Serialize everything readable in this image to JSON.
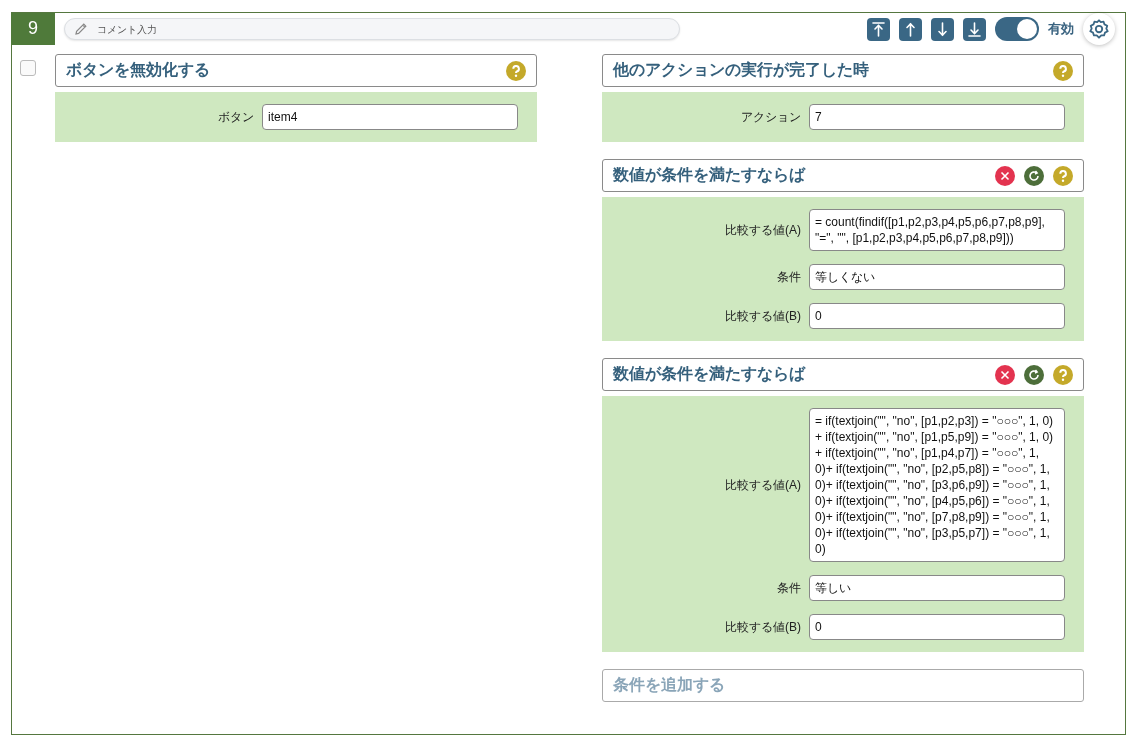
{
  "row_number": "9",
  "comment": {
    "placeholder": "コメント入力"
  },
  "toolbar": {
    "enabled": {
      "on": true,
      "label": "有効"
    }
  },
  "select": {
    "checked": false
  },
  "action": {
    "title": "ボタンを無効化する",
    "fields": [
      {
        "label": "ボタン",
        "value": "item4"
      }
    ]
  },
  "trigger": {
    "title": "他のアクションの実行が完了した時",
    "fields": [
      {
        "label": "アクション",
        "value": "7"
      }
    ]
  },
  "conditions": [
    {
      "title": "数値が条件を満たすならば",
      "fields": [
        {
          "label": "比較する値(A)",
          "value": "= count(findif([p1,p2,p3,p4,p5,p6,p7,p8,p9], \"=\", \"\", [p1,p2,p3,p4,p5,p6,p7,p8,p9]))"
        },
        {
          "label": "条件",
          "value": "等しくない"
        },
        {
          "label": "比較する値(B)",
          "value": "0"
        }
      ]
    },
    {
      "title": "数値が条件を満たすならば",
      "fields": [
        {
          "label": "比較する値(A)",
          "value": "= if(textjoin(\"\", \"no\", [p1,p2,p3]) = \"○○○\", 1, 0) +  if(textjoin(\"\", \"no\", [p1,p5,p9]) = \"○○○\", 1, 0) +  if(textjoin(\"\", \"no\", [p1,p4,p7]) = \"○○○\", 1, 0)+ if(textjoin(\"\", \"no\", [p2,p5,p8]) = \"○○○\", 1, 0)+ if(textjoin(\"\", \"no\", [p3,p6,p9]) = \"○○○\", 1, 0)+ if(textjoin(\"\", \"no\", [p4,p5,p6]) = \"○○○\", 1, 0)+ if(textjoin(\"\", \"no\", [p7,p8,p9]) = \"○○○\", 1, 0)+ if(textjoin(\"\", \"no\", [p3,p5,p7]) = \"○○○\", 1, 0)"
        },
        {
          "label": "条件",
          "value": "等しい"
        },
        {
          "label": "比較する値(B)",
          "value": "0"
        }
      ]
    }
  ],
  "add_condition": {
    "label": "条件を追加する"
  }
}
